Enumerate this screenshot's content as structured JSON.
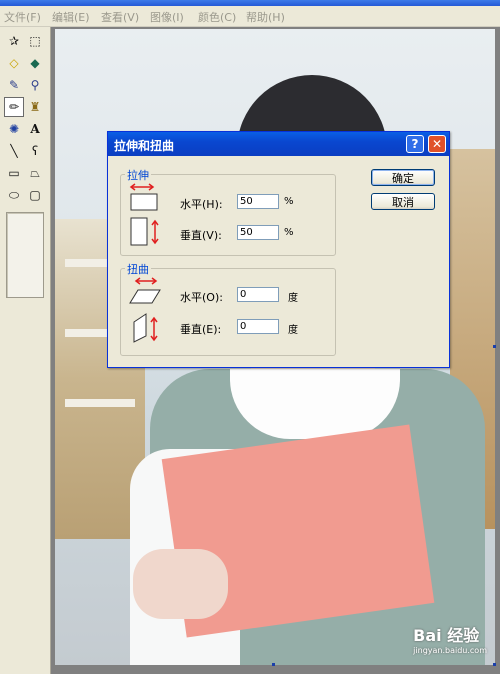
{
  "menu": [
    "文件(F)",
    "编辑(E)",
    "查看(V)",
    "图像(I)",
    "颜色(C)",
    "帮助(H)"
  ],
  "tools": [
    {
      "icon": "free-select-icon",
      "glyph": "✰"
    },
    {
      "icon": "rect-select-icon",
      "glyph": "⬚"
    },
    {
      "icon": "eraser-icon",
      "glyph": "◇"
    },
    {
      "icon": "fill-bucket-icon",
      "glyph": "◆"
    },
    {
      "icon": "color-picker-icon",
      "glyph": "✎"
    },
    {
      "icon": "magnifier-icon",
      "glyph": "⚲"
    },
    {
      "icon": "pencil-icon",
      "glyph": "✏"
    },
    {
      "icon": "brush-icon",
      "glyph": "♜"
    },
    {
      "icon": "airbrush-icon",
      "glyph": "✺"
    },
    {
      "icon": "text-icon",
      "glyph": "A"
    },
    {
      "icon": "line-icon",
      "glyph": "╲"
    },
    {
      "icon": "curve-icon",
      "glyph": "ʕ"
    },
    {
      "icon": "rectangle-icon",
      "glyph": "▭"
    },
    {
      "icon": "polygon-icon",
      "glyph": "⏢"
    },
    {
      "icon": "ellipse-icon",
      "glyph": "⬭"
    },
    {
      "icon": "rounded-rect-icon",
      "glyph": "▢"
    }
  ],
  "dialog": {
    "title": "拉伸和扭曲",
    "help": "?",
    "close": "✕",
    "stretch": {
      "label": "拉伸",
      "horizontal_label": "水平(H):",
      "horizontal_value": "50",
      "horizontal_unit": "%",
      "vertical_label": "垂直(V):",
      "vertical_value": "50",
      "vertical_unit": "%"
    },
    "skew": {
      "label": "扭曲",
      "horizontal_label": "水平(O):",
      "horizontal_value": "0",
      "horizontal_unit": "度",
      "vertical_label": "垂直(E):",
      "vertical_value": "0",
      "vertical_unit": "度"
    },
    "ok": "确定",
    "cancel": "取消"
  },
  "watermark": {
    "brand": "Bai 经验",
    "url": "jingyan.baidu.com"
  }
}
